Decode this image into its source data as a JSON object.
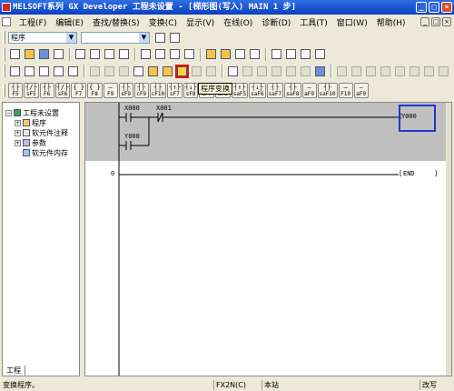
{
  "window": {
    "title": "MELSOFT系列 GX Developer 工程未设置 - [梯形图(写入)        MAIN      1 步]"
  },
  "menu": [
    "工程(F)",
    "编辑(E)",
    "查找/替换(S)",
    "变换(C)",
    "显示(V)",
    "在线(O)",
    "诊断(D)",
    "工具(T)",
    "窗口(W)",
    "帮助(H)"
  ],
  "toolbar": {
    "data_type_combo": "程序",
    "program_combo": "",
    "tooltip": "程序变换"
  },
  "fkeys": [
    {
      "sym": "┤├",
      "label": "F5"
    },
    {
      "sym": "┤/├",
      "label": "sF5"
    },
    {
      "sym": "┤├",
      "label": "F6"
    },
    {
      "sym": "┤/├",
      "label": "sF6"
    },
    {
      "sym": "{ }",
      "label": "F7"
    },
    {
      "sym": "{ }",
      "label": "F8"
    },
    {
      "sym": "—",
      "label": "F9"
    },
    {
      "sym": "┤├",
      "label": "sF9"
    },
    {
      "sym": "┤├",
      "label": "cF9"
    },
    {
      "sym": "┤├",
      "label": "cF10"
    },
    {
      "sym": "┤↑├",
      "label": "sF7"
    },
    {
      "sym": "┤↓├",
      "label": "sF8"
    },
    {
      "sym": "┤↑├",
      "label": "aF7"
    },
    {
      "sym": "┤↓├",
      "label": "aF8"
    },
    {
      "sym": "┤↑├",
      "label": "saF5"
    },
    {
      "sym": "┤↓├",
      "label": "saF6"
    },
    {
      "sym": "┤├",
      "label": "saF7"
    },
    {
      "sym": "┤├",
      "label": "saF8"
    },
    {
      "sym": "—",
      "label": "aF9"
    },
    {
      "sym": "┤├",
      "label": "saF10"
    },
    {
      "sym": "—",
      "label": "F10"
    },
    {
      "sym": "—",
      "label": "aF9"
    }
  ],
  "project_tree": {
    "root": "工程未设置",
    "items": [
      "程序",
      "软元件注释",
      "参数",
      "软元件内存"
    ],
    "tab": "工程"
  },
  "ladder": {
    "contact1": "X000",
    "contact2": "X001",
    "contact3": "Y000",
    "coil": "Y000",
    "step_number": "0",
    "end_instruction": "END"
  },
  "status": {
    "message": "变换程序。",
    "plc_type": "FX2N(C)",
    "connection": "本站",
    "mode": "改写"
  },
  "colors": {
    "title_bar": "#0a3fbf",
    "selected_circuit": "#c0c0c0",
    "cursor": "#1a3ad0",
    "highlight_box": "#e01010"
  }
}
